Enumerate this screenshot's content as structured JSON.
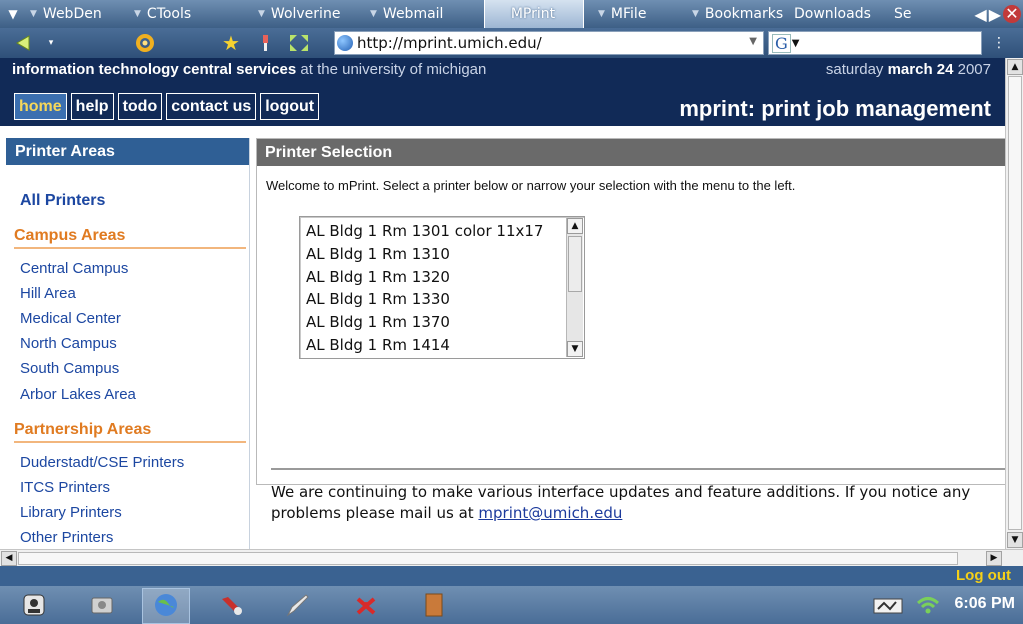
{
  "browser": {
    "tabs": [
      {
        "label": "WebDen",
        "active": false
      },
      {
        "label": "CTools",
        "active": false
      },
      {
        "label": "Wolverine",
        "active": false
      },
      {
        "label": "Webmail",
        "active": false
      },
      {
        "label": "MPrint",
        "active": true
      },
      {
        "label": "MFile",
        "active": false
      }
    ],
    "bookmarks_label": "Bookmarks",
    "downloads_label": "Downloads",
    "overflow_label": "Se",
    "url": "http://mprint.umich.edu/",
    "search_engine": "G"
  },
  "header": {
    "org_bold": "information technology central services",
    "org_rest": " at the university of michigan",
    "date_prefix": "saturday ",
    "date_bold": "march 24",
    "date_year": " 2007",
    "nav": [
      {
        "label": "home",
        "current": true
      },
      {
        "label": "help",
        "current": false
      },
      {
        "label": "todo",
        "current": false
      },
      {
        "label": "contact us",
        "current": false
      },
      {
        "label": "logout",
        "current": false
      }
    ],
    "app_title": "mprint: print job management"
  },
  "sidebar": {
    "title": "Printer Areas",
    "all_printers": "All Printers",
    "campus_heading": "Campus Areas",
    "campus_links": [
      "Central Campus",
      "Hill Area",
      "Medical Center",
      "North Campus",
      "South Campus",
      "Arbor Lakes Area"
    ],
    "partnership_heading": "Partnership Areas",
    "partnership_links": [
      "Duderstadt/CSE Printers",
      "ITCS Printers",
      "Library Printers",
      "Other Printers"
    ]
  },
  "main": {
    "title": "Printer Selection",
    "welcome": "Welcome to mPrint. Select a printer below or narrow your selection with the menu to the left.",
    "printers": [
      "AL Bldg 1 Rm 1301 color 11x17",
      "AL Bldg 1 Rm 1310",
      "AL Bldg 1 Rm 1320",
      "AL Bldg 1 Rm 1330",
      "AL Bldg 1 Rm 1370",
      "AL Bldg 1 Rm 1414"
    ],
    "notice_text": "We are continuing to make various interface updates and feature additions. If you notice any problems please mail us at ",
    "notice_email": "mprint@umich.edu"
  },
  "status": {
    "logout_label": "Log out",
    "clock": "6:06 PM"
  },
  "colors": {
    "header_bg": "#112a57",
    "sidebar_head_bg": "#2f5f95",
    "main_head_bg": "#6a6a6a",
    "section_heading": "#e07b21",
    "link": "#1c47a1",
    "logout_link": "#f5d018"
  }
}
